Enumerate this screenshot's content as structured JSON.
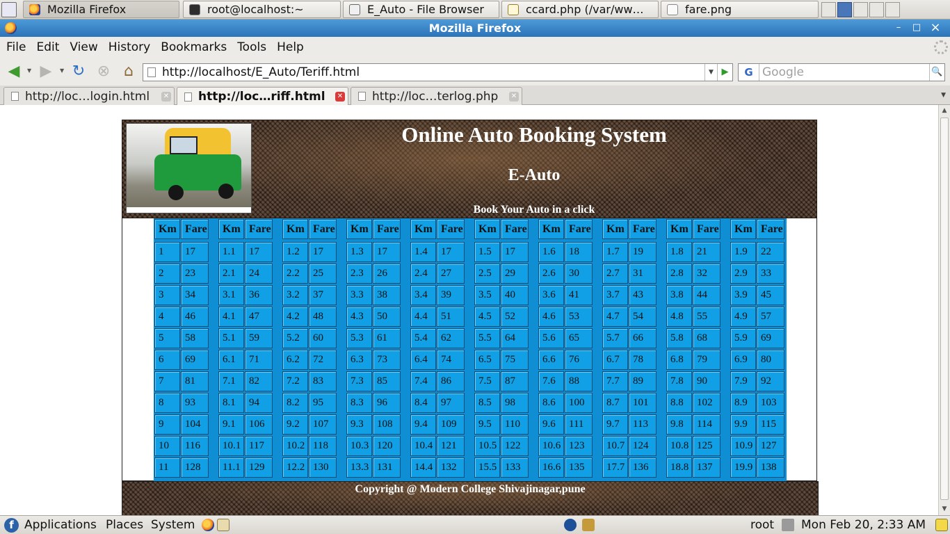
{
  "window_list": [
    {
      "label": "Mozilla Firefox",
      "icon": "firefox-icon",
      "active": false
    },
    {
      "label": "root@localhost:~",
      "icon": "terminal-icon",
      "active": false
    },
    {
      "label": "E_Auto - File Browser",
      "icon": "folder-icon",
      "active": false
    },
    {
      "label": "ccard.php (/var/ww…",
      "icon": "text-editor-icon",
      "active": false
    },
    {
      "label": "fare.png",
      "icon": "image-icon",
      "active": false
    }
  ],
  "titlebar": {
    "title": "Mozilla Firefox",
    "minimize": "–",
    "maximize": "□",
    "close": "×"
  },
  "menu": [
    "File",
    "Edit",
    "View",
    "History",
    "Bookmarks",
    "Tools",
    "Help"
  ],
  "nav": {
    "back": "back-arrow-icon",
    "forward": "forward-arrow-icon",
    "reload": "reload-icon",
    "stop": "stop-icon",
    "home": "home-icon",
    "url": "http://localhost/E_Auto/Teriff.html",
    "search_placeholder": "Google",
    "search_engine": "G"
  },
  "tabs": [
    {
      "label": "http://loc…login.html",
      "active": false
    },
    {
      "label": "http://loc…riff.html",
      "active": true
    },
    {
      "label": "http://loc…terlog.php",
      "active": false
    }
  ],
  "page": {
    "title": "Online Auto Booking System",
    "subtitle": "E-Auto",
    "tagline": "Book Your Auto in a click",
    "footer": "Copyright @ Modern College Shivajinagar,pune"
  },
  "fare_table": {
    "headers": [
      "Km",
      "Fare"
    ],
    "columns": [
      {
        "rows": [
          [
            "1",
            "17"
          ],
          [
            "2",
            "23"
          ],
          [
            "3",
            "34"
          ],
          [
            "4",
            "46"
          ],
          [
            "5",
            "58"
          ],
          [
            "6",
            "69"
          ],
          [
            "7",
            "81"
          ],
          [
            "8",
            "93"
          ],
          [
            "9",
            "104"
          ],
          [
            "10",
            "116"
          ],
          [
            "11",
            "128"
          ]
        ]
      },
      {
        "rows": [
          [
            "1.1",
            "17"
          ],
          [
            "2.1",
            "24"
          ],
          [
            "3.1",
            "36"
          ],
          [
            "4.1",
            "47"
          ],
          [
            "5.1",
            "59"
          ],
          [
            "6.1",
            "71"
          ],
          [
            "7.1",
            "82"
          ],
          [
            "8.1",
            "94"
          ],
          [
            "9.1",
            "106"
          ],
          [
            "10.1",
            "117"
          ],
          [
            "11.1",
            "129"
          ]
        ]
      },
      {
        "rows": [
          [
            "1.2",
            "17"
          ],
          [
            "2.2",
            "25"
          ],
          [
            "3.2",
            "37"
          ],
          [
            "4.2",
            "48"
          ],
          [
            "5.2",
            "60"
          ],
          [
            "6.2",
            "72"
          ],
          [
            "7.2",
            "83"
          ],
          [
            "8.2",
            "95"
          ],
          [
            "9.2",
            "107"
          ],
          [
            "10.2",
            "118"
          ],
          [
            "12.2",
            "130"
          ]
        ]
      },
      {
        "rows": [
          [
            "1.3",
            "17"
          ],
          [
            "2.3",
            "26"
          ],
          [
            "3.3",
            "38"
          ],
          [
            "4.3",
            "50"
          ],
          [
            "5.3",
            "61"
          ],
          [
            "6.3",
            "73"
          ],
          [
            "7.3",
            "85"
          ],
          [
            "8.3",
            "96"
          ],
          [
            "9.3",
            "108"
          ],
          [
            "10.3",
            "120"
          ],
          [
            "13.3",
            "131"
          ]
        ]
      },
      {
        "rows": [
          [
            "1.4",
            "17"
          ],
          [
            "2.4",
            "27"
          ],
          [
            "3.4",
            "39"
          ],
          [
            "4.4",
            "51"
          ],
          [
            "5.4",
            "62"
          ],
          [
            "6.4",
            "74"
          ],
          [
            "7.4",
            "86"
          ],
          [
            "8.4",
            "97"
          ],
          [
            "9.4",
            "109"
          ],
          [
            "10.4",
            "121"
          ],
          [
            "14.4",
            "132"
          ]
        ]
      },
      {
        "rows": [
          [
            "1.5",
            "17"
          ],
          [
            "2.5",
            "29"
          ],
          [
            "3.5",
            "40"
          ],
          [
            "4.5",
            "52"
          ],
          [
            "5.5",
            "64"
          ],
          [
            "6.5",
            "75"
          ],
          [
            "7.5",
            "87"
          ],
          [
            "8.5",
            "98"
          ],
          [
            "9.5",
            "110"
          ],
          [
            "10.5",
            "122"
          ],
          [
            "15.5",
            "133"
          ]
        ]
      },
      {
        "rows": [
          [
            "1.6",
            "18"
          ],
          [
            "2.6",
            "30"
          ],
          [
            "3.6",
            "41"
          ],
          [
            "4.6",
            "53"
          ],
          [
            "5.6",
            "65"
          ],
          [
            "6.6",
            "76"
          ],
          [
            "7.6",
            "88"
          ],
          [
            "8.6",
            "100"
          ],
          [
            "9.6",
            "111"
          ],
          [
            "10.6",
            "123"
          ],
          [
            "16.6",
            "135"
          ]
        ]
      },
      {
        "rows": [
          [
            "1.7",
            "19"
          ],
          [
            "2.7",
            "31"
          ],
          [
            "3.7",
            "43"
          ],
          [
            "4.7",
            "54"
          ],
          [
            "5.7",
            "66"
          ],
          [
            "6.7",
            "78"
          ],
          [
            "7.7",
            "89"
          ],
          [
            "8.7",
            "101"
          ],
          [
            "9.7",
            "113"
          ],
          [
            "10.7",
            "124"
          ],
          [
            "17.7",
            "136"
          ]
        ]
      },
      {
        "rows": [
          [
            "1.8",
            "21"
          ],
          [
            "2.8",
            "32"
          ],
          [
            "3.8",
            "44"
          ],
          [
            "4.8",
            "55"
          ],
          [
            "5.8",
            "68"
          ],
          [
            "6.8",
            "79"
          ],
          [
            "7.8",
            "90"
          ],
          [
            "8.8",
            "102"
          ],
          [
            "9.8",
            "114"
          ],
          [
            "10.8",
            "125"
          ],
          [
            "18.8",
            "137"
          ]
        ]
      },
      {
        "rows": [
          [
            "1.9",
            "22"
          ],
          [
            "2.9",
            "33"
          ],
          [
            "3.9",
            "45"
          ],
          [
            "4.9",
            "57"
          ],
          [
            "5.9",
            "69"
          ],
          [
            "6.9",
            "80"
          ],
          [
            "7.9",
            "92"
          ],
          [
            "8.9",
            "103"
          ],
          [
            "9.9",
            "115"
          ],
          [
            "10.9",
            "127"
          ],
          [
            "19.9",
            "138"
          ]
        ]
      }
    ]
  },
  "bottom_panel": {
    "applications": "Applications",
    "places": "Places",
    "system": "System",
    "user": "root",
    "clock": "Mon Feb 20,  2:33 AM"
  },
  "colors": {
    "table_bg": "#11a0e6",
    "titlebar": "#3a86c8",
    "banner": "#4a3324"
  }
}
